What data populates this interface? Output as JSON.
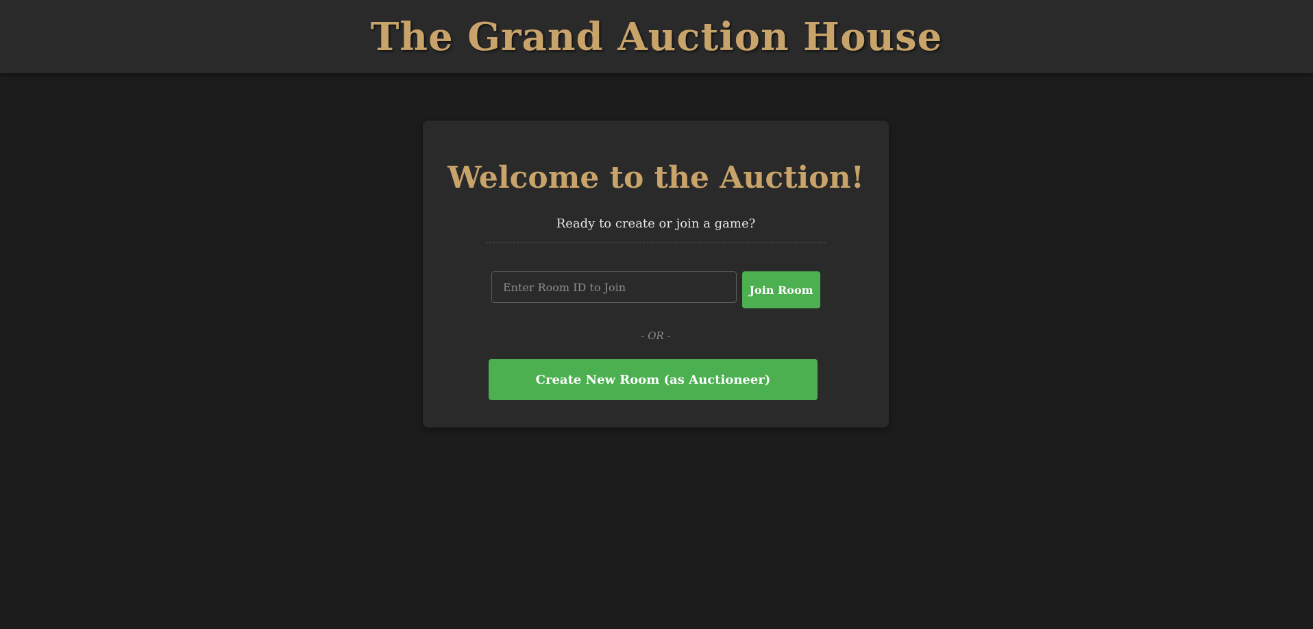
{
  "header": {
    "title": "The Grand Auction House"
  },
  "welcome": {
    "title": "Welcome to the Auction!",
    "subtitle": "Ready to create or join a game?"
  },
  "join": {
    "input_value": "",
    "input_placeholder": "Enter Room ID to Join",
    "button_label": "Join Room"
  },
  "separator": {
    "label": "- OR -"
  },
  "create": {
    "button_label": "Create New Room (as Auctioneer)"
  },
  "colors": {
    "page_background": "#1c1c1c",
    "panel_background": "#2a2a2a",
    "accent_gold": "#c9a46a",
    "button_green": "#4caf50",
    "muted_text": "#8c8c8c"
  }
}
